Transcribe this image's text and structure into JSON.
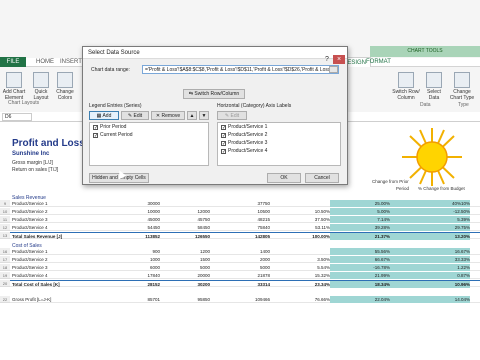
{
  "ribbon": {
    "file_tab": "FILE",
    "tabs": [
      "HOME",
      "INSERT"
    ],
    "right_tabs": [
      "DESIGN",
      "FORMAT"
    ],
    "chart_tools": "CHART TOOLS",
    "left_buttons": [
      {
        "label": "Add Chart Element"
      },
      {
        "label": "Quick Layout"
      },
      {
        "label": "Change Colors"
      }
    ],
    "group_chart_layouts": "Chart Layouts",
    "right_buttons": [
      {
        "label": "Switch Row/ Column"
      },
      {
        "label": "Select Data"
      },
      {
        "label": "Change Chart Type"
      }
    ],
    "group_data": "Data",
    "group_type": "Type"
  },
  "namebox": "D6",
  "sheet": {
    "title": "Profit and Loss B",
    "company": "Sunshine Inc",
    "gross_margin": "Gross margin  [L/J]",
    "return_on_sales": "Return on sales  [T/J]",
    "header_right_1": "Change from Prior",
    "header_right_2": "Period",
    "header_right_3": "% Change from Budget",
    "sales_revenue": "Sales Revenue",
    "cost_of_sales": "Cost of Sales",
    "rows": [
      {
        "n": "9",
        "label": "Product/Service 1",
        "a": "30000",
        "b": "",
        "c": "37750",
        "d": "",
        "e": "25.00%",
        "f": "40%10%"
      },
      {
        "n": "10",
        "label": "Product/Service 2",
        "a": "10000",
        "b": "12000",
        "c": "10500",
        "d": "10.50%",
        "e": "5.00%",
        "f": "-12.50%"
      },
      {
        "n": "11",
        "label": "Product/Service 3",
        "a": "45000",
        "b": "45750",
        "c": "48215",
        "d": "37.50%",
        "e": "7.14%",
        "f": "5.39%"
      },
      {
        "n": "12",
        "label": "Product/Service 4",
        "a": "54450",
        "b": "58450",
        "c": "75840",
        "d": "53.11%",
        "e": "39.28%",
        "f": "29.75%"
      },
      {
        "n": "13",
        "label": "Total Sales Revenue  [J]",
        "a": "113852",
        "b": "126550",
        "c": "142805",
        "d": "100.00%",
        "e": "21.37%",
        "f": "13.20%",
        "bold": true
      }
    ],
    "cost_rows": [
      {
        "n": "16",
        "label": "Product/Service 1",
        "a": "900",
        "b": "1200",
        "c": "1400",
        "d": "",
        "e": "55.56%",
        "f": "16.67%"
      },
      {
        "n": "17",
        "label": "Product/Service 2",
        "a": "1000",
        "b": "1500",
        "c": "2000",
        "d": "3.50%",
        "e": "66.67%",
        "f": "33.33%"
      },
      {
        "n": "18",
        "label": "Product/Service 3",
        "a": "6000",
        "b": "5000",
        "c": "5000",
        "d": "5.54%",
        "e": "-16.78%",
        "f": "1.22%"
      },
      {
        "n": "19",
        "label": "Product/Service 4",
        "a": "17840",
        "b": "20000",
        "c": "21878",
        "d": "15.32%",
        "e": "21.99%",
        "f": "0.87%"
      },
      {
        "n": "20",
        "label": "Total Cost of Sales  [K]",
        "a": "28152",
        "b": "30200",
        "c": "33314",
        "d": "23.34%",
        "e": "18.34%",
        "f": "10.96%",
        "bold": true
      }
    ],
    "gross_row": {
      "n": "22",
      "label": "Gross Profit  [L=J-K]",
      "a": "85701",
      "b": "95850",
      "c": "109466",
      "d": "76.66%",
      "e": "22.04%",
      "f": "14.04%"
    }
  },
  "dialog": {
    "title": "Select Data Source",
    "help": "?",
    "close": "×",
    "range_label": "Chart data range:",
    "range_value": "='Profit & Loss'!$A$8:$C$8,'Profit & Loss'!$D$11,'Profit & Loss'!$D$26,'Profit & Loss'!$E",
    "switch_button": "Switch Row/Column",
    "legend_label": "Legend Entries (Series)",
    "axis_label": "Horizontal (Category) Axis Labels",
    "add": "Add",
    "edit": "Edit",
    "remove": "Remove",
    "edit2": "Edit",
    "series": [
      "Prior Period",
      "Current Period"
    ],
    "categories": [
      "Product/Service 1",
      "Product/Service 2",
      "Product/Service 3",
      "Product/Service 4"
    ],
    "hidden_button": "Hidden and Empty Cells",
    "ok": "OK",
    "cancel": "Cancel"
  }
}
